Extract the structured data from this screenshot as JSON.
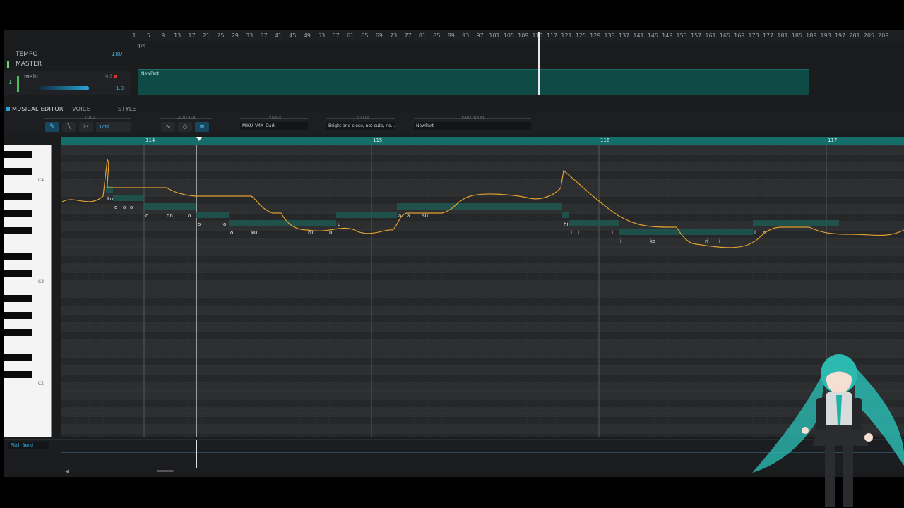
{
  "arrangement": {
    "ruler_numbers": [
      "1",
      "5",
      "9",
      "13",
      "17",
      "21",
      "25",
      "29",
      "33",
      "37",
      "41",
      "45",
      "49",
      "53",
      "57",
      "61",
      "65",
      "69",
      "73",
      "77",
      "81",
      "85",
      "89",
      "93",
      "97",
      "101",
      "105",
      "109",
      "113",
      "117",
      "121",
      "125",
      "129",
      "133",
      "137",
      "141",
      "145",
      "149",
      "153",
      "157",
      "161",
      "165",
      "169",
      "173",
      "177",
      "181",
      "185",
      "189",
      "193",
      "197",
      "201",
      "205",
      "209"
    ],
    "time_signature": "4/4",
    "tempo_label": "TEMPO",
    "tempo_value": "180",
    "master_label": "MASTER",
    "track": {
      "number": "1",
      "name": "main",
      "volume": "1.0",
      "volume_level": 0.95
    },
    "part_name": "NewPart"
  },
  "tabs": [
    {
      "label": "MUSICAL EDITOR",
      "active": true
    },
    {
      "label": "VOICE",
      "active": false
    },
    {
      "label": "STYLE",
      "active": false
    }
  ],
  "toolbar": {
    "tool_label": "TOOL",
    "control_label": "CONTROL",
    "voice_label": "VOICE",
    "style_label": "STYLE",
    "part_name_label": "PART NAME",
    "quantize": "1/32",
    "voice_value": "MIKU_V4X_Dark",
    "style_value": "Bright and close, not cute, no...",
    "part_name_value": "NewPart"
  },
  "editor": {
    "measures": [
      "114",
      "115",
      "116",
      "117"
    ],
    "key_labels": [
      "C4",
      "C3",
      "C2"
    ],
    "notes": [
      {
        "lyric": "ko",
        "pitch": "C4"
      },
      {
        "lyric": "o",
        "pitch": "A3"
      },
      {
        "lyric": "o",
        "pitch": "A3"
      },
      {
        "lyric": "o",
        "pitch": "A3"
      },
      {
        "lyric": "o",
        "pitch": "G3"
      },
      {
        "lyric": "do",
        "pitch": "G3"
      },
      {
        "lyric": "o",
        "pitch": "G3"
      },
      {
        "lyric": "o",
        "pitch": "F3"
      },
      {
        "lyric": "o",
        "pitch": "F3"
      },
      {
        "lyric": "o",
        "pitch": "E3"
      },
      {
        "lyric": "ku",
        "pitch": "E3"
      },
      {
        "lyric": "ru",
        "pitch": "E3"
      },
      {
        "lyric": "u",
        "pitch": "E3"
      },
      {
        "lyric": "u",
        "pitch": "F3"
      },
      {
        "lyric": "a",
        "pitch": "G3"
      },
      {
        "lyric": "a",
        "pitch": "G3"
      },
      {
        "lyric": "su",
        "pitch": "G3"
      },
      {
        "lyric": "hi",
        "pitch": "F3"
      },
      {
        "lyric": "i",
        "pitch": "E3"
      },
      {
        "lyric": "i",
        "pitch": "E3"
      },
      {
        "lyric": "i",
        "pitch": "E3"
      },
      {
        "lyric": "i",
        "pitch": "D3"
      },
      {
        "lyric": "ka",
        "pitch": "D3"
      },
      {
        "lyric": "ri",
        "pitch": "D3"
      },
      {
        "lyric": "i",
        "pitch": "D3"
      },
      {
        "lyric": "i",
        "pitch": "E3"
      },
      {
        "lyric": "e",
        "pitch": "E3"
      }
    ],
    "parameter_select": "Pitch Bend"
  },
  "colors": {
    "accent": "#2aa3d8",
    "part": "#0e4a46",
    "note": "#1d5a52",
    "pitch_curve": "#e0a030"
  }
}
